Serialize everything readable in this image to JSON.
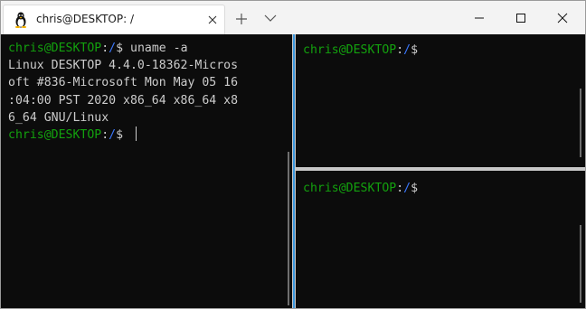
{
  "tab": {
    "title": "chris@DESKTOP: /",
    "icon": "linux-penguin-icon"
  },
  "window_controls": [
    "minimize",
    "maximize",
    "close"
  ],
  "colors": {
    "prompt_user": "#13a10e",
    "prompt_path": "#3b78ff",
    "text": "#cccccc",
    "background": "#0c0c0c",
    "active_pane_border": "#3a96dd"
  },
  "left_pane": {
    "prompt_user": "chris@DESKTOP",
    "prompt_sep": ":",
    "prompt_path": "/",
    "prompt_end": "$ ",
    "command": "uname -a",
    "output": [
      "Linux DESKTOP 4.4.0-18362-Micros",
      "oft #836-Microsoft Mon May 05 16",
      ":04:00 PST 2020 x86_64 x86_64 x8",
      "6_64 GNU/Linux"
    ]
  },
  "top_right_pane": {
    "prompt_user": "chris@DESKTOP",
    "prompt_sep": ":",
    "prompt_path": "/",
    "prompt_end": "$"
  },
  "bottom_right_pane": {
    "prompt_user": "chris@DESKTOP",
    "prompt_sep": ":",
    "prompt_path": "/",
    "prompt_end": "$"
  }
}
